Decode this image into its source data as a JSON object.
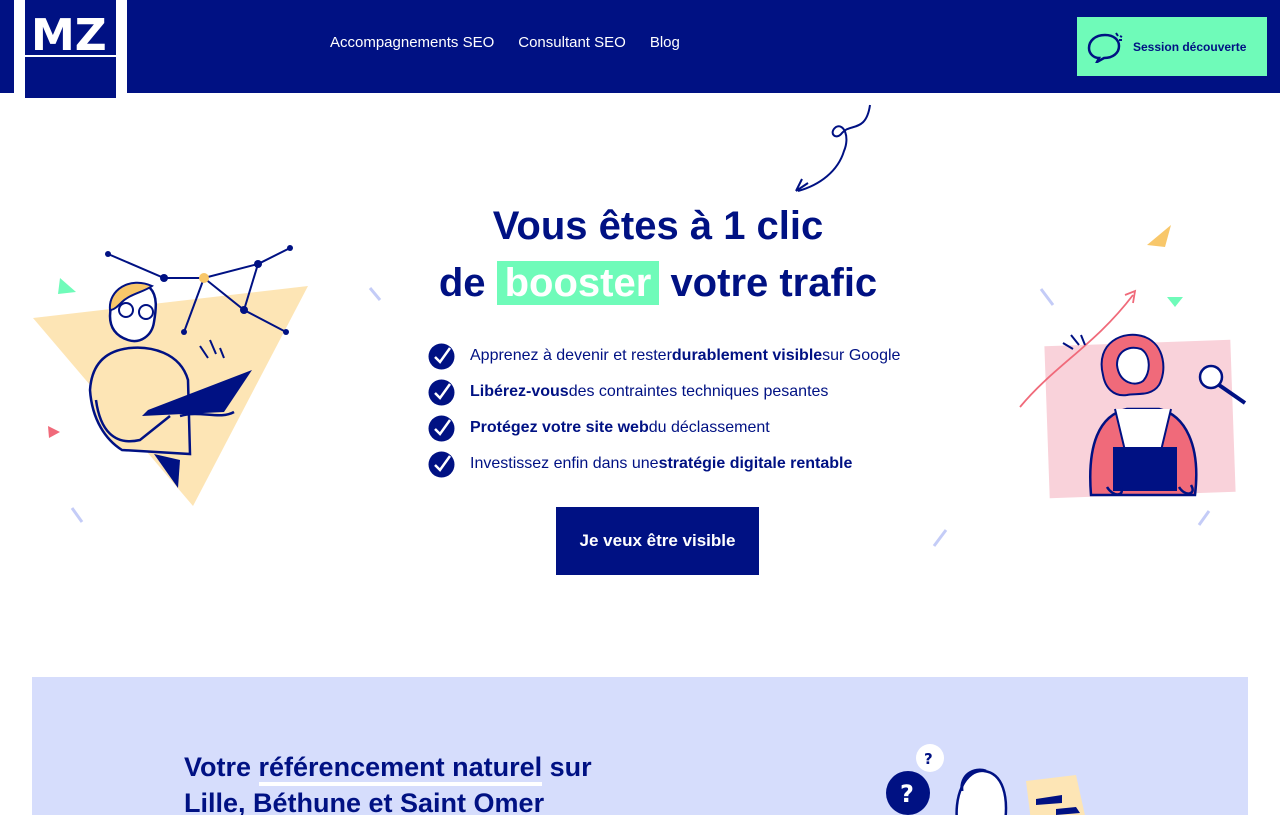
{
  "header": {
    "logo_text": "MZ",
    "nav": [
      {
        "label": "Accompagnements SEO"
      },
      {
        "label": "Consultant SEO"
      },
      {
        "label": "Blog"
      }
    ],
    "cta": {
      "label": "Session découverte",
      "icon": "speech-bubble-icon"
    }
  },
  "hero": {
    "title_line1": "Vous êtes à 1 clic",
    "title_pre": "de",
    "title_highlight": "booster",
    "title_post": "votre trafic",
    "benefits": [
      {
        "pre": "Apprenez à devenir et rester ",
        "bold": "durablement visible",
        "post": " sur Google"
      },
      {
        "pre": "",
        "bold": "Libérez-vous",
        "post": " des contraintes techniques pesantes"
      },
      {
        "pre": "",
        "bold": "Protégez votre site web",
        "post": " du déclassement"
      },
      {
        "pre": "Investissez enfin dans une ",
        "bold": "stratégie digitale rentable",
        "post": ""
      }
    ],
    "button_label": "Je veux être visible"
  },
  "section2": {
    "title_pre": "Votre ",
    "title_underlined": "référencement naturel",
    "title_post": " sur",
    "title_line2": "Lille, Béthune et Saint Omer",
    "question_mark": "?"
  },
  "colors": {
    "navy": "#001183",
    "mint": "#6ffbb9",
    "light_blue": "#d6ddfc",
    "peach": "#fde5b5",
    "pink": "#f9d2da"
  }
}
